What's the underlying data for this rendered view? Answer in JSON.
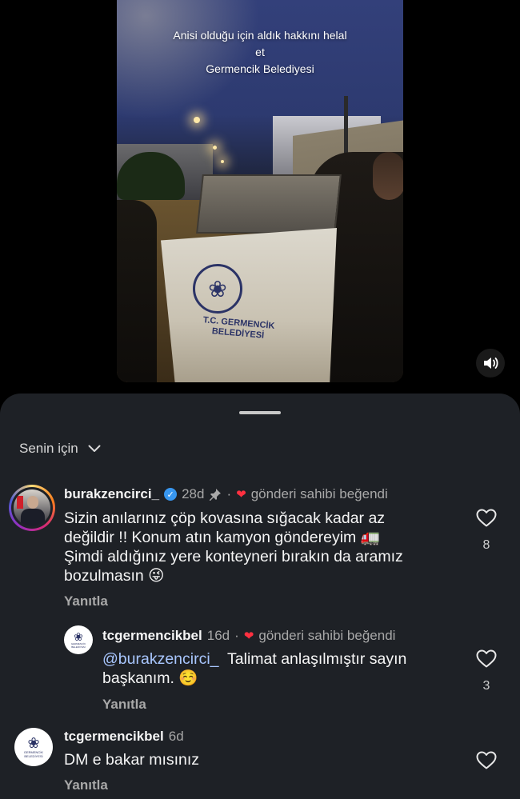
{
  "video": {
    "caption_lines": [
      "Anisi olduğu için aldık hakkını helal",
      "et",
      "Germencik Belediyesi"
    ],
    "bin_text": "T.C. GERMENCİK BELEDİYESİ",
    "mute_icon": "speaker-icon"
  },
  "sheet": {
    "sort_label": "Senin için"
  },
  "comments": [
    {
      "username": "burakzencirci_",
      "verified": true,
      "age": "28d",
      "pinned": true,
      "liked_by_creator": "gönderi sahibi beğendi",
      "text_lines": [
        "Sizin anılarınız çöp kovasına sığacak kadar az",
        "değildir !! Konum atın kamyon göndereyim 🚛",
        "Şimdi aldığınız yere konteyneri bırakın da aramız",
        "bozulmasın 😜"
      ],
      "reply_label": "Yanıtla",
      "like_count": "8"
    },
    {
      "username": "tcgermencikbel",
      "age": "16d",
      "liked_by_creator": "gönderi sahibi beğendi",
      "mention": "@burakzencirci_",
      "text_after_mention": "Talimat anlaşılmıştır sayın",
      "text_line2": "başkanım. ☺️",
      "reply_label": "Yanıtla",
      "like_count": "3",
      "avatar_text": "GERMENCİK BELEDİYESİ"
    },
    {
      "username": "tcgermencikbel",
      "age": "6d",
      "text": "DM e bakar mısınız",
      "reply_label": "Yanıtla",
      "avatar_text": "GERMENCİK BELEDİYESİ"
    }
  ],
  "colors": {
    "sheet_bg": "#1e2126",
    "mention": "#a9c7ff",
    "heart_red": "#ff3040",
    "verified_blue": "#3897f0"
  }
}
